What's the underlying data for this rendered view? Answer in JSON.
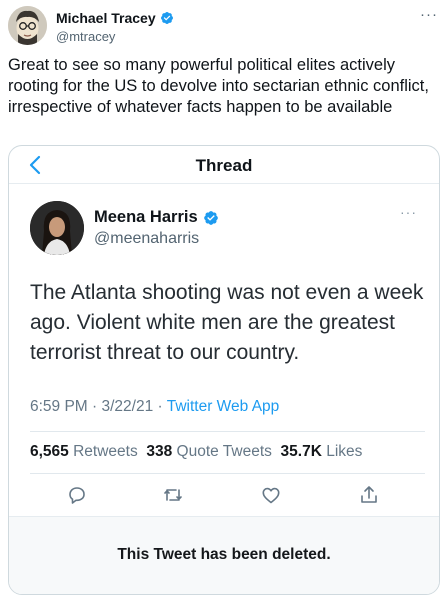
{
  "outer_tweet": {
    "name": "Michael Tracey",
    "handle": "@mtracey",
    "more": "···",
    "text": "Great to see so many powerful political elites actively rooting for the US to devolve into sectarian ethnic conflict, irrespective of whatever facts happen to be available"
  },
  "quoted": {
    "thread_title": "Thread",
    "name": "Meena Harris",
    "handle": "@meenaharris",
    "more": "···",
    "text": "The Atlanta shooting was not even a week ago. Violent white men are the greatest terrorist threat to our country.",
    "time": "6:59 PM · 3/22/21 · ",
    "source": "Twitter Web App",
    "retweets_count": "6,565",
    "retweets_label": "Retweets",
    "quote_count": "338",
    "quote_label": "Quote Tweets",
    "likes_count": "35.7K",
    "likes_label": "Likes",
    "deleted_notice": "This Tweet has been deleted."
  },
  "colors": {
    "accent": "#1d9bf0",
    "verified": "#1d9bf0",
    "muted": "#657786"
  }
}
